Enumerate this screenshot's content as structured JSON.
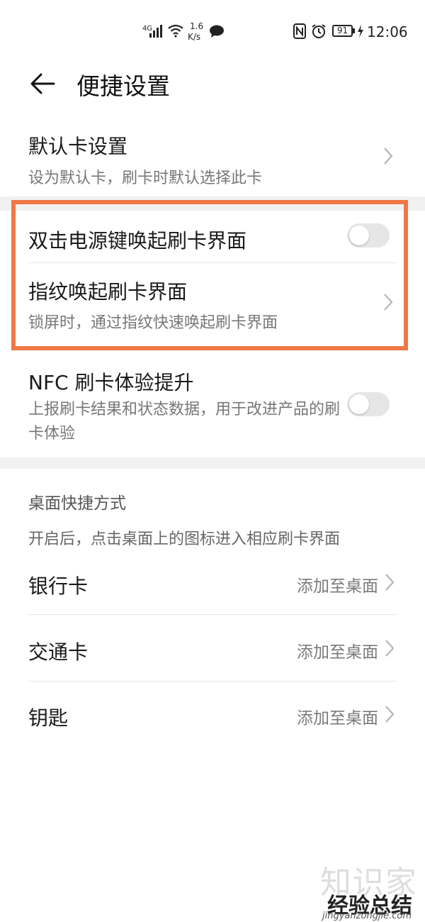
{
  "status_bar": {
    "signal_label": "4G",
    "speed_value": "1.6",
    "speed_unit": "K/s",
    "battery": "91",
    "time": "12:06"
  },
  "header": {
    "title": "便捷设置"
  },
  "default_card": {
    "title": "默认卡设置",
    "subtitle": "设为默认卡，刷卡时默认选择此卡"
  },
  "double_click": {
    "title": "双击电源键唤起刷卡界面",
    "enabled": false
  },
  "fingerprint": {
    "title": "指纹唤起刷卡界面",
    "subtitle": "锁屏时，通过指纹快速唤起刷卡界面"
  },
  "nfc": {
    "title": "NFC 刷卡体验提升",
    "subtitle": "上报刷卡结果和状态数据，用于改进产品的刷卡体验",
    "enabled": false
  },
  "shortcuts": {
    "section_title": "桌面快捷方式",
    "hint": "开启后，点击桌面上的图标进入相应刷卡界面",
    "items": [
      {
        "label": "银行卡",
        "action": "添加至桌面"
      },
      {
        "label": "交通卡",
        "action": "添加至桌面"
      },
      {
        "label": "钥匙",
        "action": "添加至桌面"
      }
    ]
  },
  "watermark": {
    "line1": "知识家",
    "line2": "经验总结",
    "line3": "jingyanzongjie.com"
  },
  "colors": {
    "highlight": "#f07846",
    "background": "#ffffff",
    "band": "#f1f1f1"
  }
}
